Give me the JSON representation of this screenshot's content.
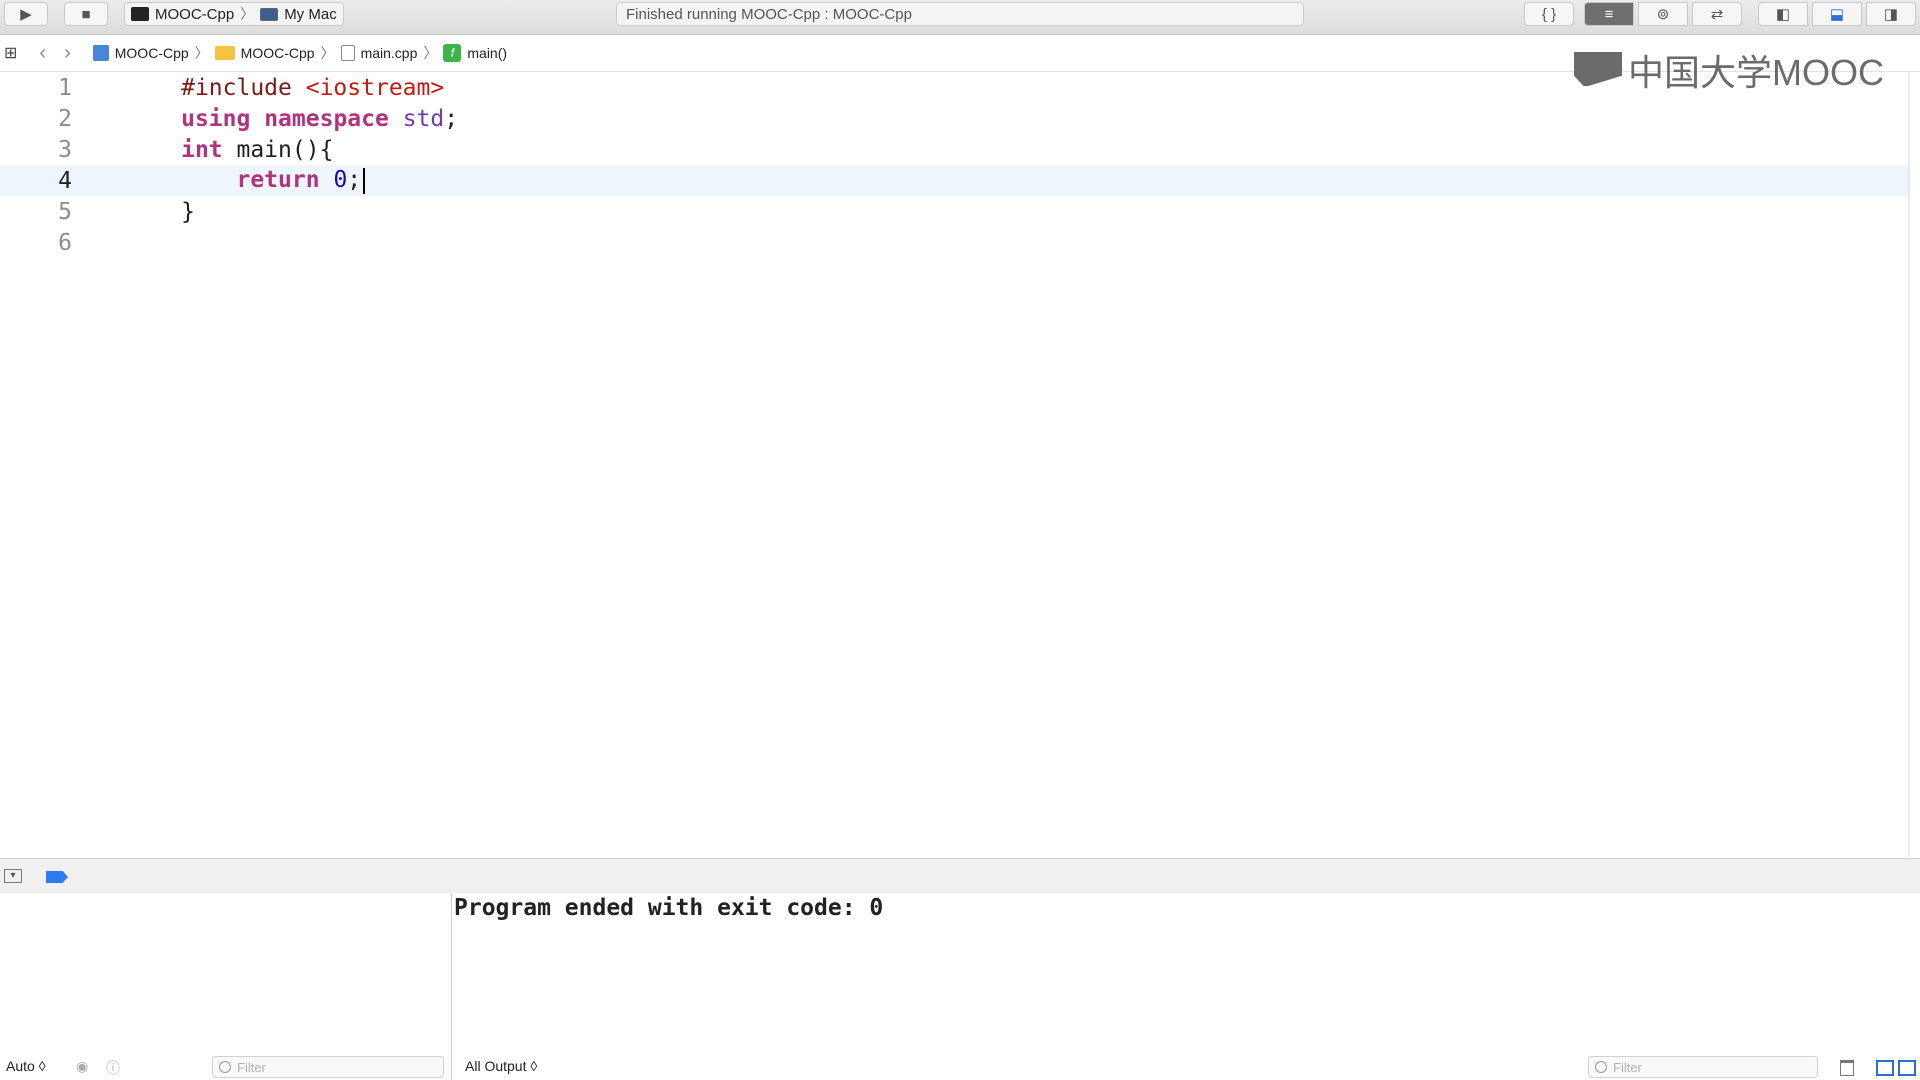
{
  "toolbar": {
    "run_label": "▶",
    "stop_label": "■",
    "scheme": {
      "target": "MOOC-Cpp",
      "destination": "My Mac"
    },
    "status": "Finished running MOOC-Cpp : MOOC-Cpp",
    "braces_label": "{ }"
  },
  "jumpbar": {
    "crumbs": [
      "MOOC-Cpp",
      "MOOC-Cpp",
      "main.cpp",
      "main()"
    ],
    "back_label": "‹",
    "forward_label": "›"
  },
  "editor": {
    "line_numbers": [
      "1",
      "2",
      "3",
      "4",
      "5",
      "6"
    ],
    "current_line": "4",
    "code": {
      "l1_pp": "#include",
      "l1_header": "<iostream>",
      "l2_using": "using",
      "l2_namespace": "namespace",
      "l2_std": "std",
      "l2_semi": ";",
      "l3_int": "int",
      "l3_rest": " main(){",
      "l4_indent": "    ",
      "l4_return": "return",
      "l4_num": "0",
      "l4_semi": ";",
      "l5": "}"
    }
  },
  "logo": {
    "text": "中国大学MOOC"
  },
  "console": {
    "output": "Program ended with exit code: 0"
  },
  "bottombar": {
    "auto_label": "Auto ◊",
    "left_filter_placeholder": "Filter",
    "all_output_label": "All Output ◊",
    "right_filter_placeholder": "Filter"
  },
  "colors": {
    "accent": "#2d7bf0",
    "keyword": "#b2337d",
    "number": "#1c00cf",
    "type": "#703daa",
    "preprocessor": "#7b1a16"
  }
}
